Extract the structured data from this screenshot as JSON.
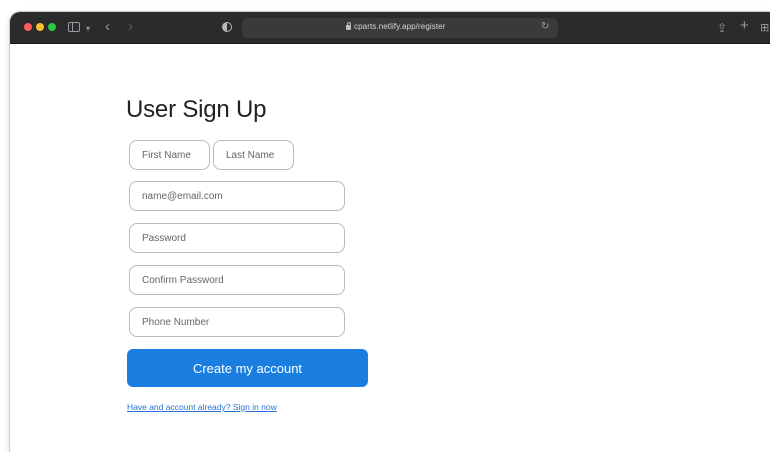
{
  "browser": {
    "url": "cparts.netlify.app/register"
  },
  "form": {
    "title": "User Sign Up",
    "first_name_placeholder": "First Name",
    "last_name_placeholder": "Last Name",
    "email_placeholder": "name@email.com",
    "password_placeholder": "Password",
    "confirm_password_placeholder": "Confirm Password",
    "phone_placeholder": "Phone Number",
    "submit_label": "Create my account",
    "signin_link": "Have and account already? Sign in now"
  },
  "colors": {
    "primary_button": "#1a7ee0",
    "link": "#2a6fd6",
    "toolbar": "#2b2b2d"
  }
}
